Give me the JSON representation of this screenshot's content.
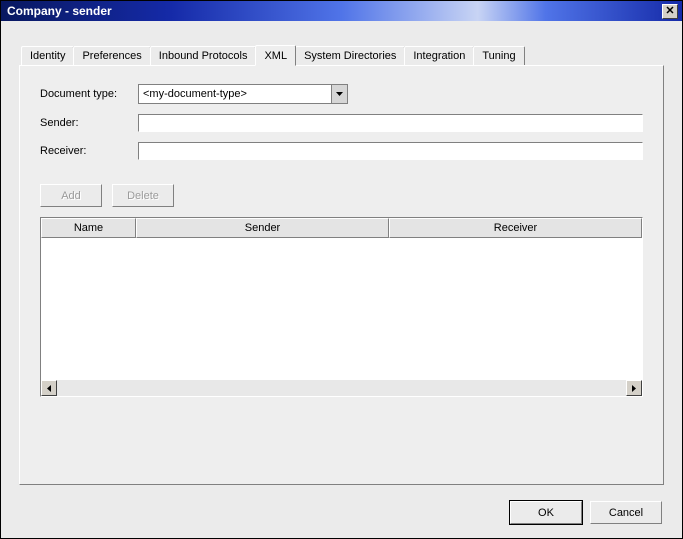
{
  "title": "Company - sender",
  "tabs": [
    {
      "label": "Identity"
    },
    {
      "label": "Preferences"
    },
    {
      "label": "Inbound Protocols"
    },
    {
      "label": "XML"
    },
    {
      "label": "System Directories"
    },
    {
      "label": "Integration"
    },
    {
      "label": "Tuning"
    }
  ],
  "activeTabIndex": 3,
  "form": {
    "docTypeLabel": "Document type:",
    "docTypeValue": "<my-document-type>",
    "senderLabel": "Sender:",
    "senderValue": "",
    "receiverLabel": "Receiver:",
    "receiverValue": ""
  },
  "buttons": {
    "add": "Add",
    "delete": "Delete",
    "ok": "OK",
    "cancel": "Cancel"
  },
  "table": {
    "headers": {
      "name": "Name",
      "sender": "Sender",
      "receiver": "Receiver"
    },
    "rows": []
  }
}
